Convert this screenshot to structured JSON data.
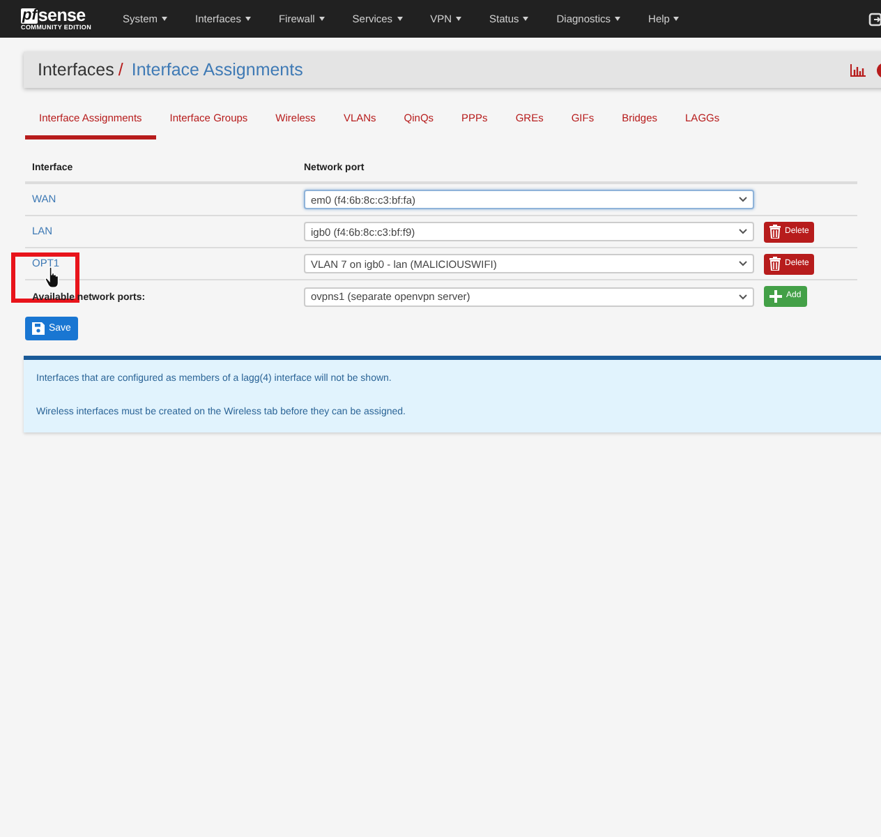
{
  "navbar": {
    "logo_prefix": "pf",
    "logo_name": "sense",
    "logo_subtitle": "COMMUNITY EDITION",
    "menu": [
      {
        "label": "System"
      },
      {
        "label": "Interfaces"
      },
      {
        "label": "Firewall"
      },
      {
        "label": "Services"
      },
      {
        "label": "VPN"
      },
      {
        "label": "Status"
      },
      {
        "label": "Diagnostics"
      },
      {
        "label": "Help"
      }
    ]
  },
  "breadcrumb": {
    "parent": "Interfaces",
    "separator": "/",
    "current": "Interface Assignments"
  },
  "tabs": [
    {
      "label": "Interface Assignments",
      "selected": true
    },
    {
      "label": "Interface Groups",
      "selected": false
    },
    {
      "label": "Wireless",
      "selected": false
    },
    {
      "label": "VLANs",
      "selected": false
    },
    {
      "label": "QinQs",
      "selected": false
    },
    {
      "label": "PPPs",
      "selected": false
    },
    {
      "label": "GREs",
      "selected": false
    },
    {
      "label": "GIFs",
      "selected": false
    },
    {
      "label": "Bridges",
      "selected": false
    },
    {
      "label": "LAGGs",
      "selected": false
    }
  ],
  "table": {
    "columns": [
      "Interface",
      "Network port"
    ],
    "rows": [
      {
        "interface": "WAN",
        "port": "em0 (f4:6b:8c:c3:bf:fa)",
        "focused": true
      },
      {
        "interface": "LAN",
        "port": "igb0 (f4:6b:8c:c3:bf:f9)",
        "button": "Delete"
      },
      {
        "interface": "OPT1",
        "port": "VLAN 7 on igb0 - lan (MALICIOUSWIFI)",
        "button": "Delete",
        "highlighted": true
      }
    ],
    "available": {
      "label": "Available network ports:",
      "port": "ovpns1 (separate openvpn server)",
      "button": "Add"
    }
  },
  "save_button": "Save",
  "notes": [
    "Interfaces that are configured as members of a lagg(4) interface will not be shown.",
    "Wireless interfaces must be created on the Wireless tab before they can be assigned."
  ]
}
